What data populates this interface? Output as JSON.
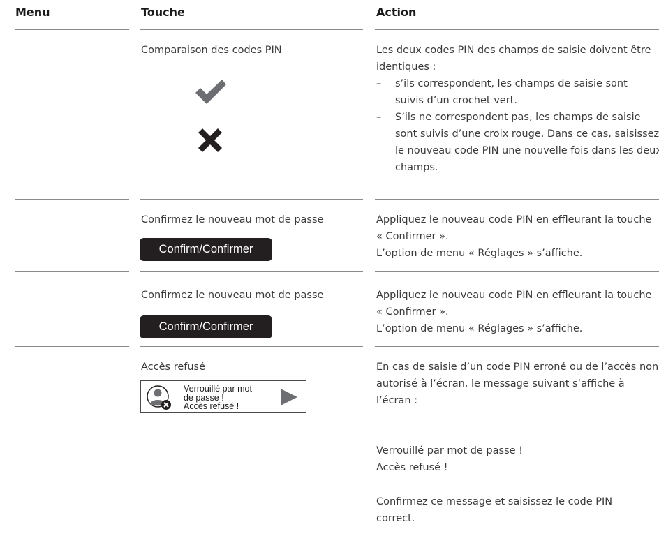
{
  "headers": {
    "menu": "Menu",
    "touche": "Touche",
    "action": "Action"
  },
  "rows": [
    {
      "touche": "Comparaison des codes PIN",
      "action_intro": "Les deux codes PIN des champs de saisie doivent être identiques :",
      "action_items": [
        "s’ils correspondent, les champs de saisie sont suivis d’un crochet vert.",
        "S’ils ne correspondent pas, les champs de saisie sont suivis d’une croix rouge. Dans ce cas, saisissez le nouveau code PIN une nouvelle fois dans les deux champs."
      ],
      "icons": [
        "checkmark-icon",
        "cross-icon"
      ]
    },
    {
      "touche": "Confirmez le nouveau mot de passe",
      "button_label": "Confirm/Confirmer",
      "action_lines": [
        "Appliquez le nouveau code PIN en effleurant la touche « Confirmer ».",
        "L’option de menu « Réglages » s’affiche."
      ]
    },
    {
      "touche": "Confirmez le nouveau mot de passe",
      "button_label": "Confirm/Confirmer",
      "action_lines": [
        "Appliquez le nouveau code PIN en effleurant la touche « Confirmer ».",
        "L’option de menu « Réglages » s’affiche."
      ]
    },
    {
      "touche": "Accès refusé",
      "screen_message": [
        "Verrouillé par mot",
        "de passe !",
        "Accès refusé !"
      ],
      "icons": [
        "user-locked-icon",
        "play-arrow-icon"
      ],
      "action_p1": "En cas de saisie d’un code PIN erroné ou de l’accès non autorisé à l’écran, le message suivant s’affiche à l’écran :",
      "action_p2": [
        "Verrouillé par mot de passe !",
        "Accès refusé !"
      ],
      "action_p3": "Confirmez ce message et saisissez le code PIN correct."
    }
  ]
}
